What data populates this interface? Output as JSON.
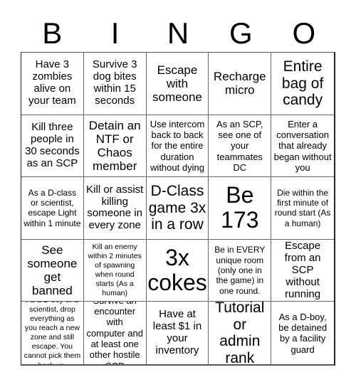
{
  "header": {
    "letters": [
      "B",
      "I",
      "N",
      "G",
      "O"
    ]
  },
  "cells": [
    "Have 3 zombies alive on your team",
    "Survive 3 dog bites within 15 seconds",
    "Escape with someone",
    "Recharge micro",
    "Entire bag of candy",
    "Kill three people in 30 seconds as an SCP",
    "Detain an NTF or Chaos member",
    "Use intercom back to back for the entire duration without dying",
    "As an SCP, see one of your teammates DC",
    "Enter a conversation that already began without you",
    "As a D-class or scientist, escape Light within 1 minute",
    "Kill or assist killing someone in every zone",
    "D-Class game 3x in a row",
    "Be 173",
    "Die within the first minute of round start (As a human)",
    "See someone get banned",
    "Kill an enemy within 2 minutes of spawning when round starts (As a human)",
    "3x cokes",
    "Be in EVERY unique room (only one in the game) in one round.",
    "Escape from an SCP without running",
    "As a D-boy or a scientist, drop everything as you reach a new zone and still escape. You cannot pick them back up.",
    "Survive an encounter with computer and at least one other hostile SCP",
    "Have at least $1 in your inventory",
    "Tutorial or admin rank",
    "As a D-boy, be detained by a facility guard"
  ]
}
